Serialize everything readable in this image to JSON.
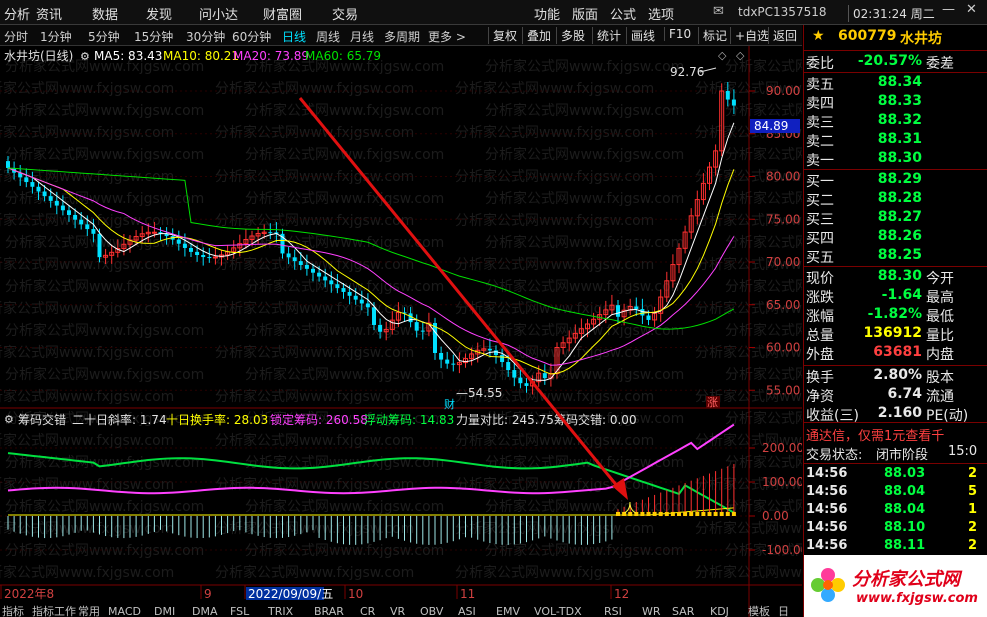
{
  "menubar": {
    "left_items": [
      "分析",
      "资讯",
      "数据",
      "发现",
      "问小达",
      "财富圈",
      "交易"
    ],
    "right_items": [
      "功能",
      "版面",
      "公式",
      "选项"
    ],
    "account": "tdxPC1357518",
    "clock": "02:31:24 周二"
  },
  "periodbar": {
    "periods": [
      "分时",
      "1分钟",
      "5分钟",
      "15分钟",
      "30分钟",
      "60分钟",
      "日线",
      "周线",
      "月线",
      "多周期",
      "更多 >"
    ],
    "active_period": "日线",
    "tools": [
      "复权",
      "叠加",
      "多股",
      "统计",
      "画线",
      "F10",
      "标记",
      "+自选",
      "返回"
    ]
  },
  "main_chart": {
    "title": "水井坊(日线)",
    "ma_labels": [
      {
        "text": "MA5: 83.43",
        "color": "#ffffff"
      },
      {
        "text": "MA10: 80.21",
        "color": "#ffff00"
      },
      {
        "text": "MA20: 73.89",
        "color": "#ff40ff"
      },
      {
        "text": "MA60: 65.79",
        "color": "#00e000"
      }
    ],
    "y_ticks": [
      "90.00",
      "85.00",
      "80.00",
      "75.00",
      "70.00",
      "65.00",
      "60.00",
      "55.00"
    ],
    "high_label": "92.76",
    "low_label": "54.55",
    "current_price_tag": "84.89",
    "marker_cai": "财",
    "marker_zhang": "涨"
  },
  "indicator": {
    "name": "筹码交错",
    "labels": [
      {
        "text": "二十日斜率: 1.74",
        "color": "#e0e0e0"
      },
      {
        "text": "十日换手率: 28.03",
        "color": "#ffff00"
      },
      {
        "text": "锁定筹码: 260.58",
        "color": "#ff40ff"
      },
      {
        "text": "浮动筹码: 14.83",
        "color": "#00ff40"
      },
      {
        "text": "力量对比: 245.75",
        "color": "#e0e0e0"
      },
      {
        "text": "筹码交错: 0.00",
        "color": "#e0e0e0"
      }
    ],
    "y_ticks": [
      "200.00",
      "100.00",
      "0.00",
      "-100.00"
    ],
    "cross_marker": "人"
  },
  "x_axis": {
    "labels": [
      "2022年8",
      "9",
      "2022/09/09/五",
      "10",
      "11",
      "12"
    ]
  },
  "bottom_tabs": [
    "指标",
    "指标工作",
    "常用",
    "MACD",
    "DMI",
    "DMA",
    "FSL",
    "TRIX",
    "BRAR",
    "CR",
    "VR",
    "OBV",
    "ASI",
    "EMV",
    "VOL-TDX",
    "RSI",
    "WR",
    "SAR",
    "KDJ",
    "模板",
    "日"
  ],
  "watermark": "分析家公式网www.fxjgsw.com",
  "stock": {
    "code": "600779",
    "name": "水井坊",
    "weibi_label": "委比",
    "weibi": "-20.57%",
    "weicha_label": "委差",
    "asks": [
      {
        "label": "卖五",
        "price": "88.34"
      },
      {
        "label": "卖四",
        "price": "88.33"
      },
      {
        "label": "卖三",
        "price": "88.32"
      },
      {
        "label": "卖二",
        "price": "88.31"
      },
      {
        "label": "卖一",
        "price": "88.30"
      }
    ],
    "bids": [
      {
        "label": "买一",
        "price": "88.29"
      },
      {
        "label": "买二",
        "price": "88.28"
      },
      {
        "label": "买三",
        "price": "88.27"
      },
      {
        "label": "买四",
        "price": "88.26"
      },
      {
        "label": "买五",
        "price": "88.25"
      }
    ],
    "stats": [
      {
        "label": "现价",
        "value": "88.30",
        "label2": "今开",
        "color": "#00ff40"
      },
      {
        "label": "涨跌",
        "value": "-1.64",
        "label2": "最高",
        "color": "#00ff40"
      },
      {
        "label": "涨幅",
        "value": "-1.82%",
        "label2": "最低",
        "color": "#00ff40"
      },
      {
        "label": "总量",
        "value": "136912",
        "label2": "量比",
        "color": "#ffff00"
      },
      {
        "label": "外盘",
        "value": "63681",
        "label2": "内盘",
        "color": "#ff4040"
      }
    ],
    "stats2": [
      {
        "label": "换手",
        "value": "2.80%",
        "label2": "股本"
      },
      {
        "label": "净资",
        "value": "6.74",
        "label2": "流通"
      },
      {
        "label": "收益(三)",
        "value": "2.160",
        "label2": "PE(动)"
      }
    ],
    "ad_text": "通达信，仅需1元查看千",
    "status_label": "交易状态:",
    "status_value": "闭市阶段",
    "status_time": "15:0",
    "ticks": [
      {
        "time": "14:56",
        "price": "88.03",
        "vol": "2"
      },
      {
        "time": "14:56",
        "price": "88.04",
        "vol": "5"
      },
      {
        "time": "14:56",
        "price": "88.04",
        "vol": "1"
      },
      {
        "time": "14:56",
        "price": "88.10",
        "vol": "2"
      },
      {
        "time": "14:56",
        "price": "88.11",
        "vol": "2"
      }
    ]
  },
  "logo": {
    "text": "分析家公式网",
    "url_text": "www.fxjgsw.com"
  }
}
